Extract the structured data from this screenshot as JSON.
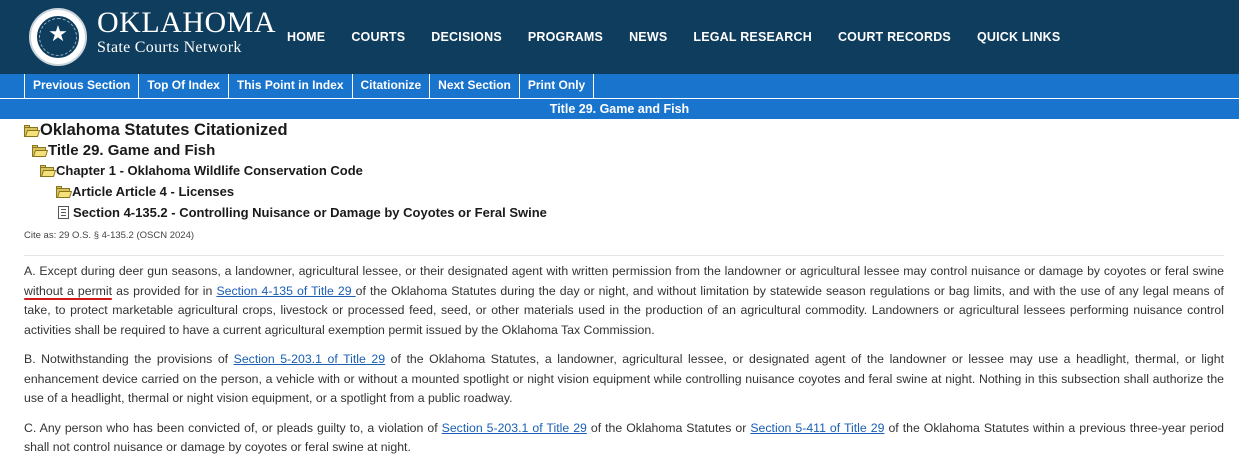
{
  "header": {
    "brand_title": "OKLAHOMA",
    "brand_subtitle": "State Courts Network",
    "seal_icon": "state-seal-icon",
    "background_color": "#0f3d5e",
    "nav": [
      {
        "label": "HOME"
      },
      {
        "label": "COURTS"
      },
      {
        "label": "DECISIONS"
      },
      {
        "label": "PROGRAMS"
      },
      {
        "label": "NEWS"
      },
      {
        "label": "LEGAL RESEARCH"
      },
      {
        "label": "COURT RECORDS"
      },
      {
        "label": "QUICK LINKS"
      }
    ]
  },
  "toolbar": {
    "background_color": "#1874cd",
    "items": [
      {
        "label": "Previous Section"
      },
      {
        "label": "Top Of Index"
      },
      {
        "label": "This Point in Index"
      },
      {
        "label": "Citationize"
      },
      {
        "label": "Next Section"
      },
      {
        "label": "Print Only"
      }
    ]
  },
  "title_bar": "Title 29. Game and Fish",
  "tree": {
    "level1": "Oklahoma Statutes Citationized",
    "level2": "Title 29. Game and Fish",
    "level3": "Chapter 1 - Oklahoma Wildlife Conservation Code",
    "level4": "Article Article 4 - Licenses",
    "level5": "Section 4-135.2 - Controlling Nuisance or Damage by Coyotes or Feral Swine"
  },
  "cite_as": "Cite as: 29 O.S. § 4-135.2 (OSCN 2024)",
  "paragraphs": {
    "a": {
      "t1": "A.  Except during deer gun seasons, a landowner, agricultural lessee, or their designated agent with written permission from the landowner or agricultural lessee may control nuisance or damage by coyotes or feral swine ",
      "highlight": "without a permit",
      "t2": " as provided for in ",
      "link1": "Section 4-135 of Title 29 ",
      "t3": "of the Oklahoma Statutes during the day or night, and without limitation by statewide season regulations or bag limits, and with the use of any legal means of take, to protect marketable agricultural crops, livestock or processed feed, seed, or other materials used in the production of an agricultural commodity. Landowners or agricultural lessees performing nuisance control activities shall be required to have a current agricultural exemption permit issued by the Oklahoma Tax Commission."
    },
    "b": {
      "t1": "B.  Notwithstanding the provisions of ",
      "link1": "Section 5-203.1 of Title 29",
      "t2": " of the Oklahoma Statutes, a landowner, agricultural lessee, or designated agent of the landowner or lessee may use a headlight, thermal, or light enhancement device carried on the person, a vehicle with or without a mounted spotlight or night vision equipment while controlling nuisance coyotes and feral swine at night.  Nothing in this subsection shall authorize the use of a headlight, thermal or night vision equipment, or a spotlight from a public roadway."
    },
    "c": {
      "t1": "C.  Any person who has been convicted of, or pleads guilty to, a violation of ",
      "link1": "Section 5-203.1 of Title 29",
      "t2": " of the Oklahoma Statutes or ",
      "link2": "Section 5-411 of Title 29",
      "t3": " of the Oklahoma Statutes within a previous three-year period shall not control nuisance or damage by coyotes or feral swine at night."
    }
  },
  "colors": {
    "link": "#1a5fb4",
    "annotation_underline": "#d11a1a"
  }
}
